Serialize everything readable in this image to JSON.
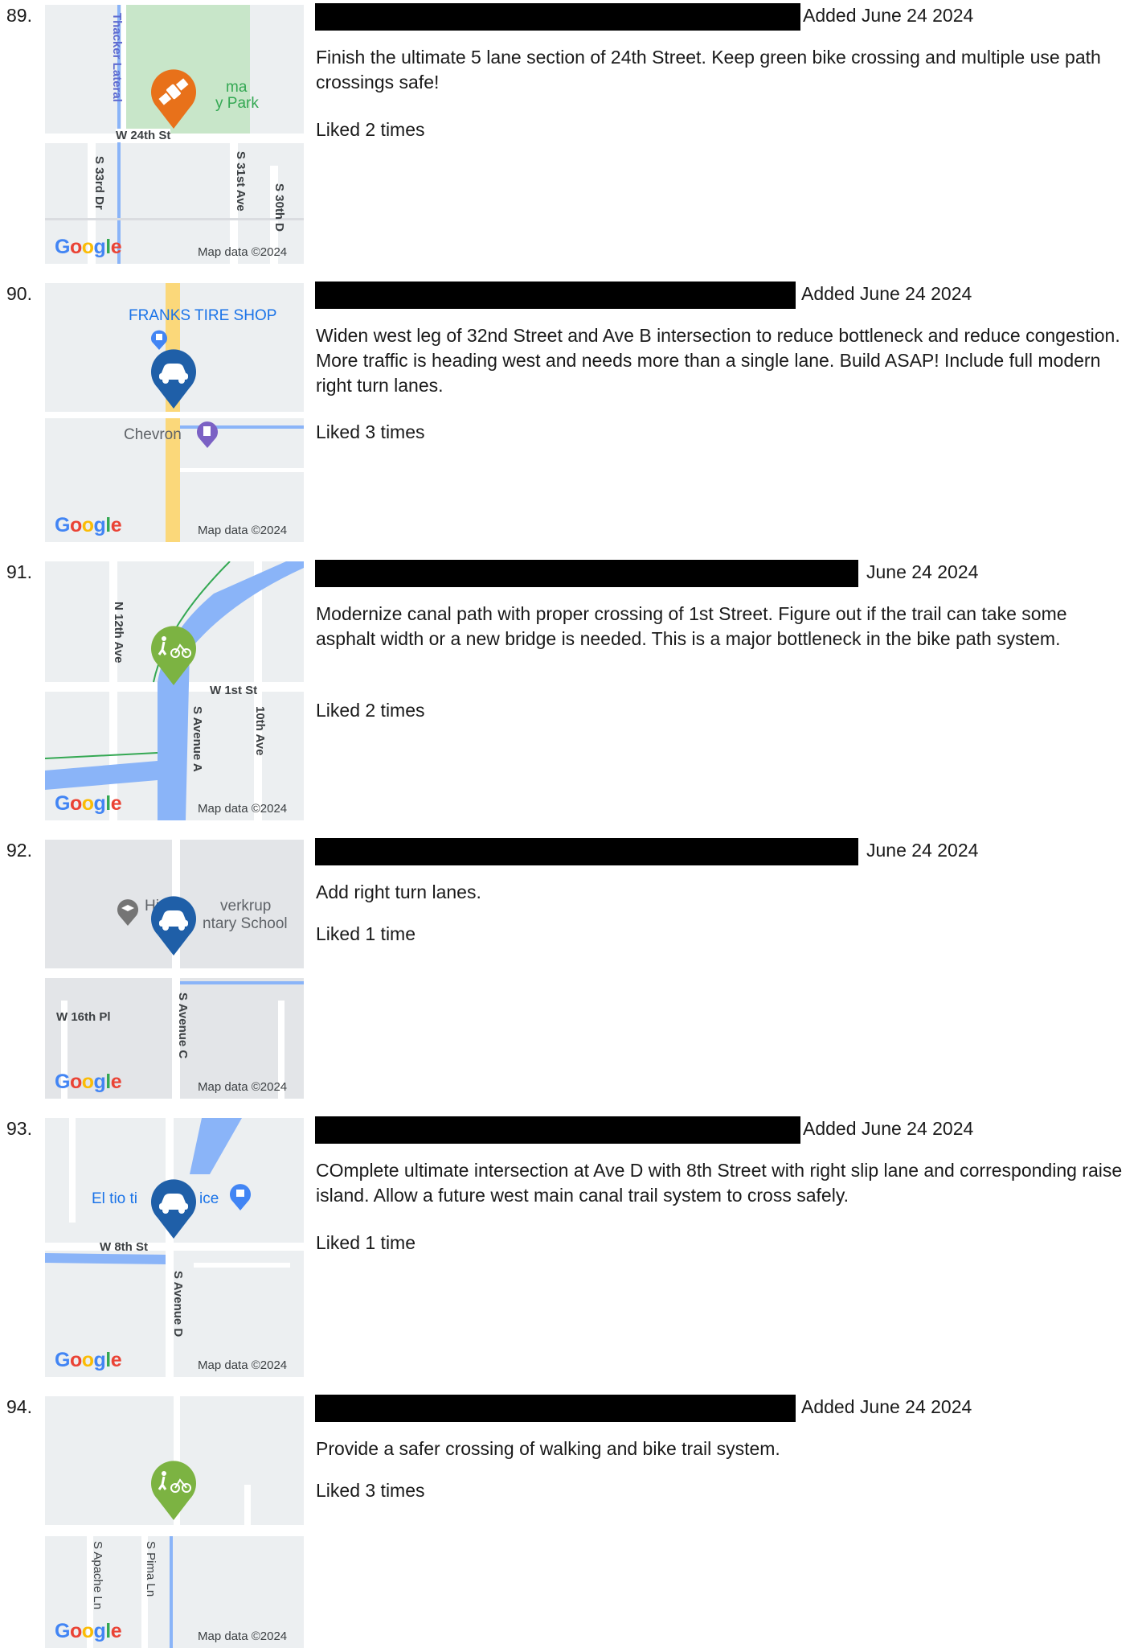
{
  "entries": [
    {
      "number": "89.",
      "date": "Added June 24 2024",
      "description": "Finish the ultimate 5 lane section of 24th Street. Keep green bike crossing and multiple use path crossings safe!",
      "likes": "Liked 2 times",
      "pin_icon": "satellite-icon",
      "pin_color": "#e8711a",
      "map": {
        "google": "Google",
        "attribution": "Map data ©2024",
        "labels": [
          "Thacker Lateral",
          "ma",
          "y Park",
          "W 24th St",
          "S 33rd Dr",
          "S 31st Ave",
          "S 30th D"
        ]
      }
    },
    {
      "number": "90.",
      "date": "Added June 24 2024",
      "description": "Widen west leg of 32nd Street and Ave B intersection to reduce bottleneck and reduce congestion. More traffic is heading west and needs more than a single lane. Build ASAP! Include full modern right turn lanes.",
      "likes": "Liked 3 times",
      "pin_icon": "car-icon",
      "pin_color": "#1f5fa8",
      "map": {
        "google": "Google",
        "attribution": "Map data ©2024",
        "labels": [
          "FRANKS TIRE SHOP",
          "Chevron"
        ]
      }
    },
    {
      "number": "91.",
      "date": "June 24 2024",
      "description": "Modernize canal path with proper crossing of 1st Street. Figure out if the trail can take some asphalt width or a new bridge is needed. This is a major bottleneck in the bike path system.",
      "likes": "Liked 2 times",
      "pin_icon": "pedestrian-bike-icon",
      "pin_color": "#7cb342",
      "map": {
        "google": "Google",
        "attribution": "Map data ©2024",
        "labels": [
          "N 12th Ave",
          "W 1st St",
          "S Avenue A",
          "10th Ave"
        ]
      }
    },
    {
      "number": "92.",
      "date": "June 24 2024",
      "description": "Add right turn lanes.",
      "likes": "Liked 1 time",
      "pin_icon": "car-icon",
      "pin_color": "#1f5fa8",
      "map": {
        "google": "Google",
        "attribution": "Map data ©2024",
        "labels": [
          "Hi",
          "verkrup",
          "ntary School",
          "W 16th Pl",
          "S Avenue C"
        ]
      }
    },
    {
      "number": "93.",
      "date": "Added June 24 2024",
      "description": "COmplete ultimate intersection at Ave D with 8th Street with right slip lane and corresponding raise island. Allow a future west main canal trail system to cross safely.",
      "likes": "Liked 1 time",
      "pin_icon": "car-icon",
      "pin_color": "#1f5fa8",
      "map": {
        "google": "Google",
        "attribution": "Map data ©2024",
        "labels": [
          "El tio ti",
          "ice",
          "W 8th St",
          "S Avenue D"
        ]
      }
    },
    {
      "number": "94.",
      "date": "Added June 24 2024",
      "description": "Provide a safer crossing of walking and bike trail system.",
      "likes": "Liked 3 times",
      "pin_icon": "pedestrian-bike-icon",
      "pin_color": "#7cb342",
      "map": {
        "google": "Google",
        "attribution": "Map data ©2024",
        "labels": [
          "S Apache Ln",
          "S Pima Ln"
        ]
      }
    }
  ]
}
